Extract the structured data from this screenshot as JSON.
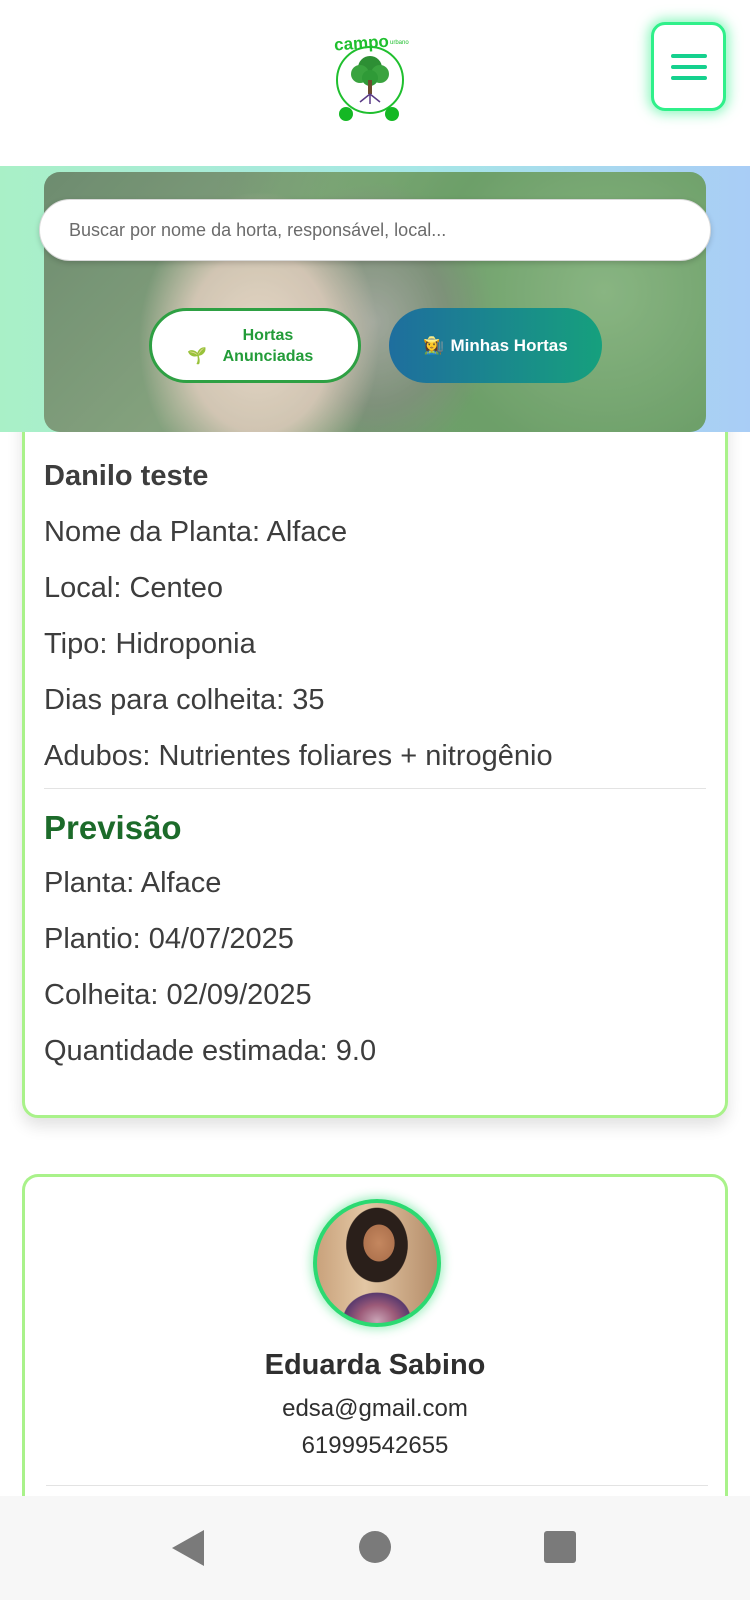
{
  "header": {
    "logo_text": "campo",
    "logo_subtext": "urbano",
    "menu_icon": "hamburger-menu-icon",
    "accent_color": "#2ff08a"
  },
  "search": {
    "placeholder": "Buscar por nome da horta, responsável, local...",
    "value": ""
  },
  "buttons": {
    "hortas_anunciadas": {
      "emoji": "🌱",
      "label": "Hortas Anunciadas"
    },
    "minhas_hortas": {
      "emoji": "👩‍🌾",
      "label": "Minhas Hortas"
    }
  },
  "horta_card": {
    "title": "Danilo teste",
    "details": [
      "Nome da Planta: Alface",
      "Local: Centeo",
      "Tipo: Hidroponia",
      "Dias para colheita: 35",
      "Adubos: Nutrientes foliares + nitrogênio"
    ],
    "previsao": {
      "title": "Previsão",
      "items": [
        "Planta: Alface",
        "Plantio: 04/07/2025",
        "Colheita: 02/09/2025",
        "Quantidade estimada: 9.0"
      ]
    },
    "border_color": "#a9f28a",
    "section_title_color": "#1c6b2a"
  },
  "contact_card": {
    "name": "Eduarda Sabino",
    "email": "edsa@gmail.com",
    "phone": "61999542655",
    "avatar_icon": "user-avatar"
  },
  "system_nav": {
    "back_icon": "back-triangle-icon",
    "home_icon": "home-circle-icon",
    "recent_icon": "recent-apps-square-icon"
  }
}
